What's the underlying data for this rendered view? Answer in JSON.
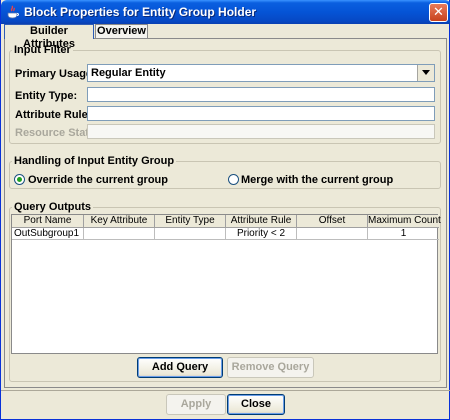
{
  "window": {
    "title": "Block Properties for Entity Group Holder",
    "close_symbol": "✕"
  },
  "tabs": [
    {
      "label": "Builder Attributes",
      "active": true
    },
    {
      "label": "Overview",
      "active": false
    }
  ],
  "input_filter": {
    "title": "Input Filter",
    "primary_usage_label": "Primary Usage:",
    "primary_usage_value": "Regular Entity",
    "entity_type_label": "Entity Type:",
    "entity_type_value": "",
    "attribute_rule_label": "Attribute Rule:",
    "attribute_rule_value": "",
    "resource_state_label": "Resource State:",
    "resource_state_value": ""
  },
  "handling": {
    "title": "Handling of Input Entity Group",
    "option_override": "Override the current group",
    "option_merge": "Merge with the current group",
    "selected": "override"
  },
  "query_outputs": {
    "title": "Query Outputs",
    "columns": [
      "Port Name",
      "Key Attribute",
      "Entity Type",
      "Attribute Rule",
      "Offset",
      "Maximum Count"
    ],
    "rows": [
      [
        "OutSubgroup1",
        "",
        "",
        "Priority < 2",
        "",
        "1"
      ]
    ],
    "add_query_label": "Add Query",
    "remove_query_label": "Remove Query"
  },
  "footer": {
    "apply_label": "Apply",
    "close_label": "Close"
  },
  "colors": {
    "titlebar": "#0554d6",
    "window_bg": "#ece9d8",
    "radio_dot": "#21a121"
  }
}
